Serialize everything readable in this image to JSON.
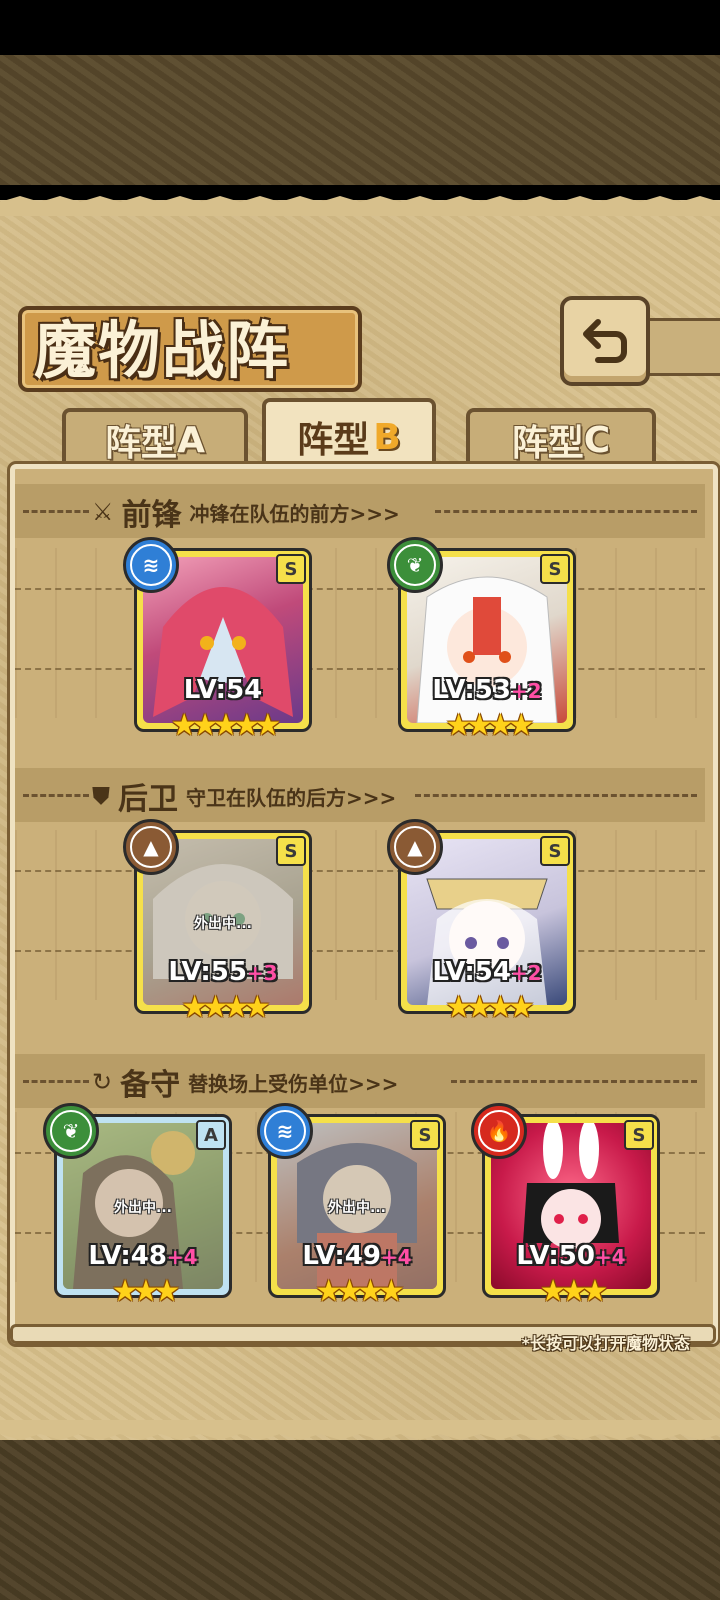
{
  "title": "魔物战阵",
  "tabs": [
    {
      "label": "阵型",
      "letter": "A",
      "active": false
    },
    {
      "label": "阵型",
      "letter": "B",
      "active": true
    },
    {
      "label": "阵型",
      "letter": "C",
      "active": false
    }
  ],
  "sections": {
    "front": {
      "icon": "sword-icon",
      "title": "前锋",
      "desc": "冲锋在队伍的前方>>>"
    },
    "back": {
      "icon": "shield-icon",
      "title": "后卫",
      "desc": "守卫在队伍的后方>>>"
    },
    "reserve": {
      "icon": "swap-icon",
      "title": "备守",
      "desc": "替换场上受伤单位>>>"
    }
  },
  "cards": {
    "front1": {
      "element": "water",
      "rank": "S",
      "level": "LV:54",
      "plus": "",
      "stars": "★★★★★",
      "away": ""
    },
    "front2": {
      "element": "leaf",
      "rank": "S",
      "level": "LV:53",
      "plus": "+2",
      "stars": "★★★★",
      "away": ""
    },
    "back1": {
      "element": "earth",
      "rank": "S",
      "level": "LV:55",
      "plus": "+3",
      "stars": "★★★★",
      "away": "外出中..."
    },
    "back2": {
      "element": "earth",
      "rank": "S",
      "level": "LV:54",
      "plus": "+2",
      "stars": "★★★★",
      "away": ""
    },
    "res1": {
      "element": "leaf",
      "rank": "A",
      "level": "LV:48",
      "plus": "+4",
      "stars": "★★★",
      "away": "外出中..."
    },
    "res2": {
      "element": "water",
      "rank": "S",
      "level": "LV:49",
      "plus": "+4",
      "stars": "★★★★",
      "away": "外出中..."
    },
    "res3": {
      "element": "fire",
      "rank": "S",
      "level": "LV:50",
      "plus": "+4",
      "stars": "★★★",
      "away": ""
    }
  },
  "hint": "*长按可以打开魔物状态",
  "colors": {
    "water": "#2f7fd6",
    "leaf": "#3c8f3a",
    "earth": "#8a5a34",
    "fire": "#d62a1e",
    "gold_frame": "#f5e04a"
  }
}
